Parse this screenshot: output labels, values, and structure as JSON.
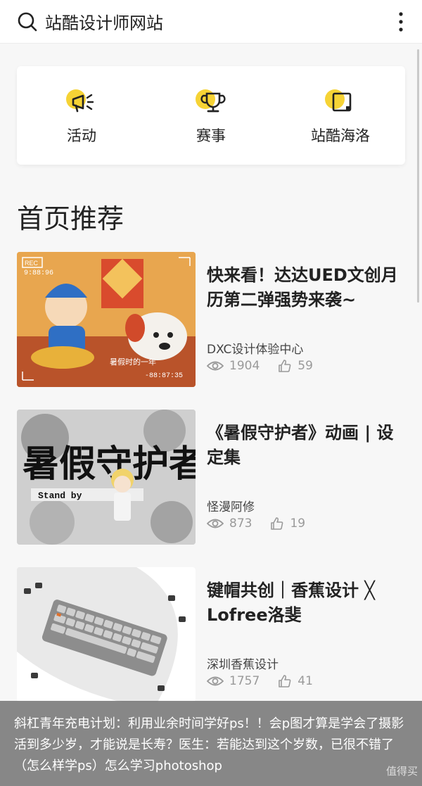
{
  "search": {
    "query": "站酷设计师网站",
    "search_icon": "search-icon",
    "more_icon": "more-vertical-icon"
  },
  "categories": [
    {
      "label": "活动",
      "icon": "megaphone-icon"
    },
    {
      "label": "赛事",
      "icon": "trophy-icon"
    },
    {
      "label": "站酷海洛",
      "icon": "image-frame-icon"
    }
  ],
  "section": {
    "title": "首页推荐"
  },
  "articles": [
    {
      "title": "快来看！达达UED文创月历第二弹强势来袭~",
      "author": "DXC设计体验中心",
      "views": "1904",
      "likes": "59"
    },
    {
      "title": "《暑假守护者》动画 | 设定集",
      "author": "怪漫阿修",
      "views": "873",
      "likes": "19"
    },
    {
      "title": "键帽共创｜香蕉设计 ╳ Lofree洛斐",
      "author": "深圳香蕉设计",
      "views": "1757",
      "likes": "41"
    }
  ],
  "ad": {
    "text": "斜杠青年充电计划：利用业余时间学好ps！！会p图才算是学会了摄影活到多少岁，才能说是长寿？医生：若能达到这个岁数，已很不错了（怎么样学ps）怎么学习photoshop",
    "watermark": "值得买"
  },
  "thumb_text": {
    "a1_rec": "REC",
    "a1_time": "9:88:96",
    "a1_caption": "暑假时的一年",
    "a1_counter": "-88:87:35",
    "a2_big": "暑假守护者",
    "a2_sub": "Stand by"
  },
  "colors": {
    "accent_yellow": "#f6d335",
    "text_primary": "#222222",
    "text_secondary": "#9a9a9a"
  }
}
